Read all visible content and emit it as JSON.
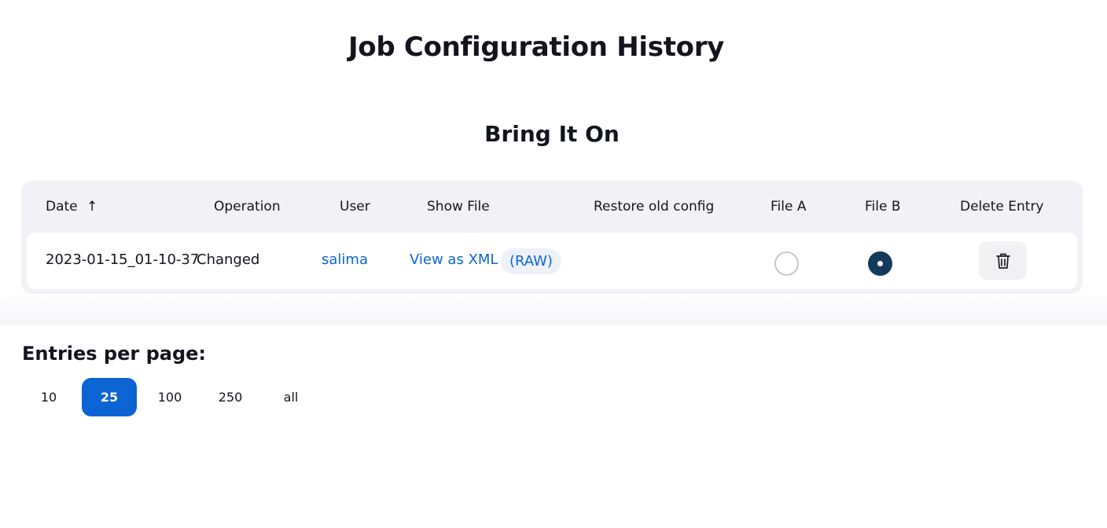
{
  "page": {
    "title": "Job Configuration History",
    "job_name": "Bring It On"
  },
  "table": {
    "headers": {
      "date": "Date",
      "date_sort_arrow": "↑",
      "operation": "Operation",
      "user": "User",
      "show_file": "Show File",
      "restore": "Restore old config",
      "file_a": "File A",
      "file_b": "File B",
      "delete": "Delete Entry"
    },
    "rows": [
      {
        "date": "2023-01-15_01-10-37",
        "operation": "Changed",
        "user": "salima",
        "view_xml": "View as XML",
        "raw": "(RAW)",
        "file_a_selected": false,
        "file_b_selected": true,
        "delete_icon": "trash-icon"
      }
    ]
  },
  "pager": {
    "label": "Entries per page:",
    "options": [
      "10",
      "25",
      "100",
      "250",
      "all"
    ],
    "selected": "25"
  },
  "colors": {
    "accent": "#0b63d4",
    "link": "#0a66d6",
    "radio_selected": "#143a5a"
  }
}
